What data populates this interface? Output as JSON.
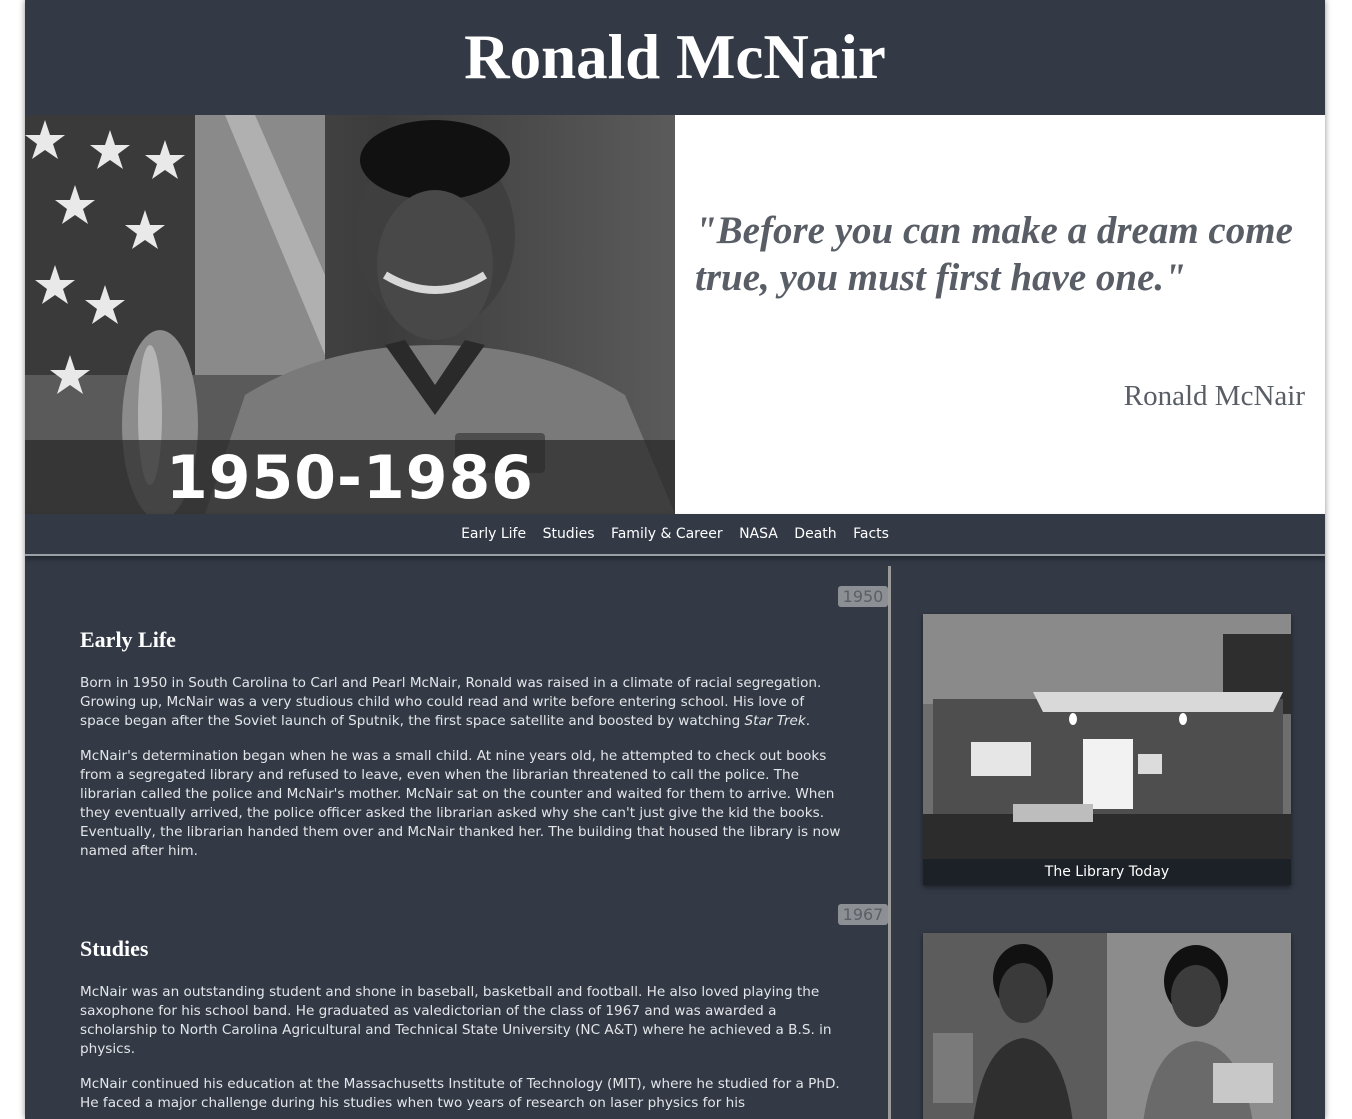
{
  "header": {
    "title": "Ronald McNair"
  },
  "hero": {
    "years": "1950-1986",
    "quote": "\"Before you can make a dream come true, you must first have one.\"",
    "quote_author": "Ronald McNair"
  },
  "nav": {
    "items": [
      "Early Life",
      "Studies",
      "Family & Career",
      "NASA",
      "Death",
      "Facts"
    ]
  },
  "sections": [
    {
      "year": "1950",
      "heading": "Early Life",
      "paragraphs": [
        "Born in 1950 in South Carolina to Carl and Pearl McNair, Ronald was raised in a climate of racial segregation. Growing up, McNair was a very studious child who could read and write before entering school. His love of space began after the Soviet launch of Sputnik, the first space satellite and boosted by watching ",
        "McNair's determination began when he was a small child. At nine years old, he attempted to check out books from a segregated library and refused to leave, even when the librarian threatened to call the police. The librarian called the police and McNair's mother. McNair sat on the counter and waited for them to arrive. When they eventually arrived, the police officer asked the librarian asked why she can't just give the kid the books. Eventually, the librarian handed them over and McNair thanked her. The building that housed the library is now named after him."
      ],
      "italic": "Star Trek",
      "after_italic": ".",
      "photo_caption": "The Library Today"
    },
    {
      "year": "1967",
      "heading": "Studies",
      "paragraphs": [
        "McNair was an outstanding student and shone in baseball, basketball and football. He also loved playing the saxophone for his school band. He graduated as valedictorian of the class of 1967 and was awarded a scholarship to North Carolina Agricultural and Technical State University (NC A&T) where he achieved a B.S. in physics.",
        "McNair continued his education at the Massachusetts Institute of Technology (MIT), where he studied for a PhD. He faced a major challenge during his studies when two years of research on laser physics for his"
      ]
    }
  ]
}
